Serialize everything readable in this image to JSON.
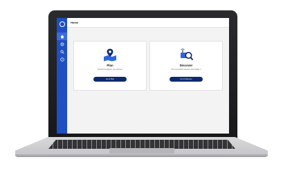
{
  "header": {
    "title": "Home"
  },
  "sidebar": {
    "items": [
      {
        "icon": "home-icon",
        "active": true
      },
      {
        "icon": "location-icon",
        "active": false
      },
      {
        "icon": "search-icon",
        "active": false
      },
      {
        "icon": "info-icon",
        "active": false
      }
    ]
  },
  "cards": {
    "plan": {
      "icon": "map-pin-icon",
      "title": "Plan",
      "description": "Add and configure your devices",
      "button": "Go to Plan"
    },
    "discover": {
      "icon": "device-search-icon",
      "title": "Discover",
      "description": "Find connected devices and update it",
      "button": "Go to Discover"
    }
  },
  "colors": {
    "sidebar": "#1f4fc2",
    "button": "#0d2a70",
    "accent": "#2c67e0"
  }
}
